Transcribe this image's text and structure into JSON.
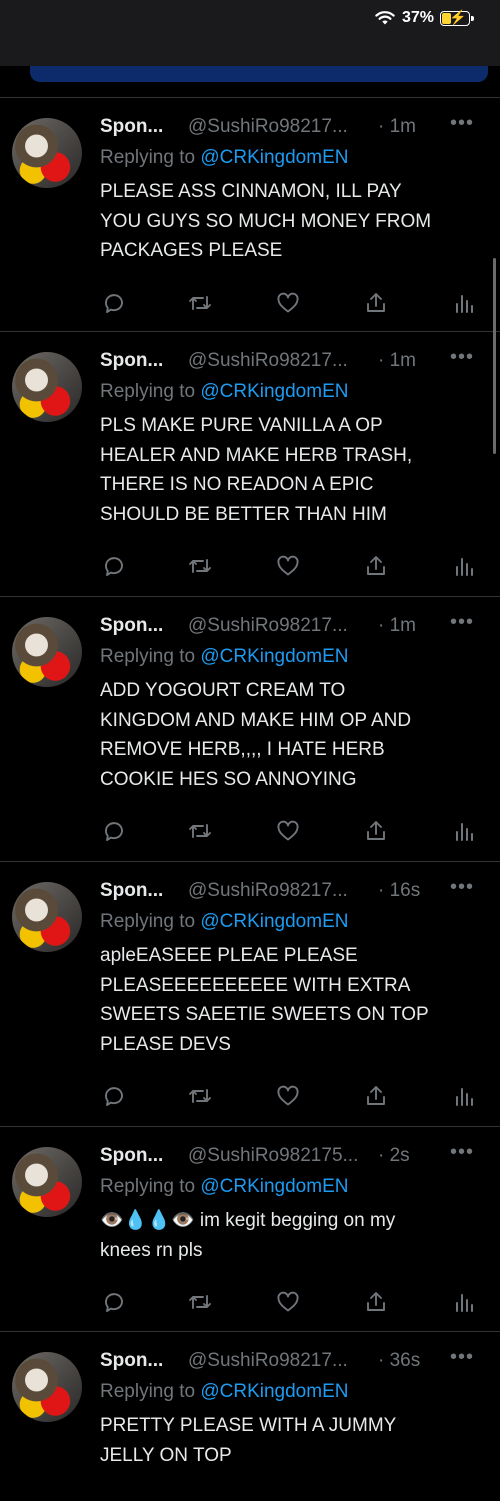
{
  "status_bar": {
    "battery_text": "37%",
    "battery_level": 0.37,
    "wifi_icon": "wifi-icon",
    "bolt_icon": "charging-bolt-icon"
  },
  "tweets": [
    {
      "name": "Spon...",
      "handle": "@SushiRo98217...",
      "time": "· 1m",
      "replying_label": "Replying to ",
      "replying_to": "@CRKingdomEN",
      "text": "PLEASE ASS CINNAMON, ILL PAY\nYOU GUYS SO MUCH MONEY FROM\nPACKAGES PLEASE"
    },
    {
      "name": "Spon...",
      "handle": "@SushiRo98217...",
      "time": "· 1m",
      "replying_label": "Replying to ",
      "replying_to": "@CRKingdomEN",
      "text": "PLS MAKE PURE VANILLA A OP\nHEALER AND MAKE HERB TRASH,\nTHERE IS NO READON A EPIC\nSHOULD BE BETTER THAN HIM"
    },
    {
      "name": "Spon...",
      "handle": "@SushiRo98217...",
      "time": "· 1m",
      "replying_label": "Replying to ",
      "replying_to": "@CRKingdomEN",
      "text": "ADD YOGOURT CREAM TO\nKINGDOM AND MAKE HIM OP AND\nREMOVE HERB,,,, I HATE HERB\nCOOKIE HES SO ANNOYING"
    },
    {
      "name": "Spon...",
      "handle": "@SushiRo98217...",
      "time": "· 16s",
      "replying_label": "Replying to ",
      "replying_to": "@CRKingdomEN",
      "text": "apleEASEEE PLEAE PLEASE\nPLEASEEEEEEEEEE WITH EXTRA\nSWEETS SAEETIE SWEETS ON TOP\nPLEASE DEVS"
    },
    {
      "name": "Spon...",
      "handle": "@SushiRo982175...",
      "time": "· 2s",
      "replying_label": "Replying to ",
      "replying_to": "@CRKingdomEN",
      "text": "👁️💧💧👁️  im  kegit  begging  on  my\nknees  rn  pls"
    },
    {
      "name": "Spon...",
      "handle": "@SushiRo98217...",
      "time": "· 36s",
      "replying_label": "Replying to ",
      "replying_to": "@CRKingdomEN",
      "text": "PRETTY PLEASE WITH A JUMMY\nJELLY ON TOP"
    }
  ],
  "more_icon_label": "•••",
  "action_icons": [
    "reply-icon",
    "retweet-icon",
    "like-icon",
    "share-icon",
    "analytics-icon"
  ],
  "colors": {
    "background": "#000000",
    "accent": "#1d9bf0",
    "secondary_text": "#71767b",
    "primary_text": "#e7e9ea"
  }
}
